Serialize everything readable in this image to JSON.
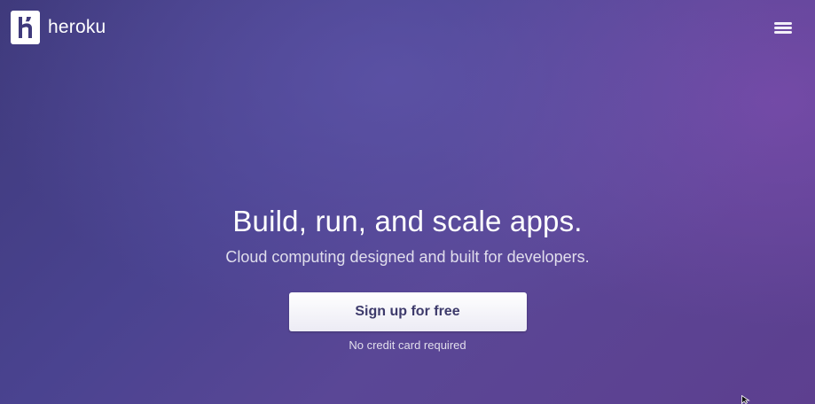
{
  "header": {
    "logo_text": "heroku",
    "logo_icon": "heroku-logo-icon",
    "menu_icon": "hamburger-menu-icon"
  },
  "hero": {
    "title": "Build, run, and scale apps.",
    "subtitle": "Cloud computing designed and built for developers.",
    "cta_label": "Sign up for free",
    "cta_note": "No credit card required"
  },
  "colors": {
    "background_primary": "#4a4390",
    "background_secondary": "#5d3f8f",
    "button_text": "#3d3a6b",
    "button_background": "#ffffff"
  },
  "cursor_icon": "mouse-pointer-icon"
}
